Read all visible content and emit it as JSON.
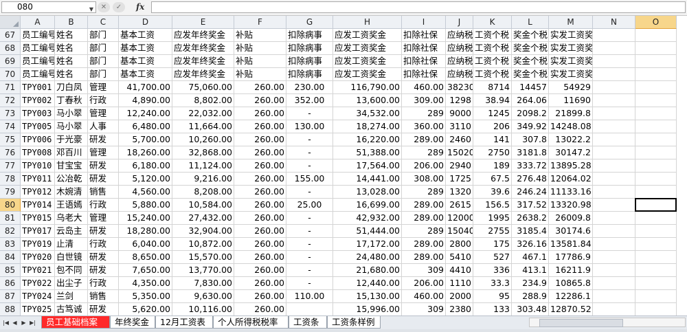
{
  "formula_bar": {
    "name_box": "080",
    "fx_label": "fx",
    "formula": ""
  },
  "columns": [
    "A",
    "B",
    "C",
    "D",
    "E",
    "F",
    "G",
    "H",
    "I",
    "J",
    "K",
    "L",
    "M",
    "N",
    "O"
  ],
  "selected_column": "O",
  "selected_row": "80",
  "rows": [
    {
      "n": "67",
      "cells": [
        "员工编号",
        "姓名",
        "部门",
        "基本工资",
        "应发年终奖金",
        "补贴",
        "扣除病事",
        "应发工资奖金",
        "扣除社保",
        "应纳税",
        "工资个税",
        "奖金个税",
        "实发工资奖金"
      ]
    },
    {
      "n": "68",
      "cells": [
        "员工编号",
        "姓名",
        "部门",
        "基本工资",
        "应发年终奖金",
        "补贴",
        "扣除病事",
        "应发工资奖金",
        "扣除社保",
        "应纳税",
        "工资个税",
        "奖金个税",
        "实发工资奖金"
      ]
    },
    {
      "n": "69",
      "cells": [
        "员工编号",
        "姓名",
        "部门",
        "基本工资",
        "应发年终奖金",
        "补贴",
        "扣除病事",
        "应发工资奖金",
        "扣除社保",
        "应纳税",
        "工资个税",
        "奖金个税",
        "实发工资奖金"
      ]
    },
    {
      "n": "70",
      "cells": [
        "员工编号",
        "姓名",
        "部门",
        "基本工资",
        "应发年终奖金",
        "补贴",
        "扣除病事",
        "应发工资奖金",
        "扣除社保",
        "应纳税",
        "工资个税",
        "奖金个税",
        "实发工资奖金"
      ]
    },
    {
      "n": "71",
      "cells": [
        "TPY001",
        "刀白凤",
        "管理",
        "41,700.00",
        "75,060.00",
        "260.00",
        "230.00",
        "116,790.00",
        "460.00",
        "38230",
        "8714",
        "14457",
        "54929"
      ]
    },
    {
      "n": "72",
      "cells": [
        "TPY002",
        "丁春秋",
        "行政",
        "4,890.00",
        "8,802.00",
        "260.00",
        "352.00",
        "13,600.00",
        "309.00",
        "1298",
        "38.94",
        "264.06",
        "11690"
      ]
    },
    {
      "n": "73",
      "cells": [
        "TPY003",
        "马小翠",
        "管理",
        "12,240.00",
        "22,032.00",
        "260.00",
        "-",
        "34,532.00",
        "289",
        "9000",
        "1245",
        "2098.2",
        "21899.8"
      ]
    },
    {
      "n": "74",
      "cells": [
        "TPY005",
        "马小翠",
        "人事",
        "6,480.00",
        "11,664.00",
        "260.00",
        "130.00",
        "18,274.00",
        "360.00",
        "3110",
        "206",
        "349.92",
        "14248.08"
      ]
    },
    {
      "n": "75",
      "cells": [
        "TPY006",
        "于光豪",
        "研发",
        "5,700.00",
        "10,260.00",
        "260.00",
        "-",
        "16,220.00",
        "289.00",
        "2460",
        "141",
        "307.8",
        "13022.2"
      ]
    },
    {
      "n": "76",
      "cells": [
        "TPY008",
        "邓百川",
        "管理",
        "18,260.00",
        "32,868.00",
        "260.00",
        "-",
        "51,388.00",
        "289",
        "15020",
        "2750",
        "3181.8",
        "30147.2"
      ]
    },
    {
      "n": "77",
      "cells": [
        "TPY010",
        "甘宝宝",
        "研发",
        "6,180.00",
        "11,124.00",
        "260.00",
        "-",
        "17,564.00",
        "206.00",
        "2940",
        "189",
        "333.72",
        "13895.28"
      ]
    },
    {
      "n": "78",
      "cells": [
        "TPY011",
        "公冶乾",
        "研发",
        "5,120.00",
        "9,216.00",
        "260.00",
        "155.00",
        "14,441.00",
        "308.00",
        "1725",
        "67.5",
        "276.48",
        "12064.02"
      ]
    },
    {
      "n": "79",
      "cells": [
        "TPY012",
        "木婉清",
        "销售",
        "4,560.00",
        "8,208.00",
        "260.00",
        "-",
        "13,028.00",
        "289",
        "1320",
        "39.6",
        "246.24",
        "11133.16"
      ]
    },
    {
      "n": "80",
      "cells": [
        "TPY014",
        "王语嫣",
        "行政",
        "5,880.00",
        "10,584.00",
        "260.00",
        "25.00",
        "16,699.00",
        "289.00",
        "2615",
        "156.5",
        "317.52",
        "13320.98"
      ]
    },
    {
      "n": "81",
      "cells": [
        "TPY015",
        "乌老大",
        "管理",
        "15,240.00",
        "27,432.00",
        "260.00",
        "-",
        "42,932.00",
        "289.00",
        "12000",
        "1995",
        "2638.2",
        "26009.8"
      ]
    },
    {
      "n": "82",
      "cells": [
        "TPY017",
        "云岛主",
        "研发",
        "18,280.00",
        "32,904.00",
        "260.00",
        "-",
        "51,444.00",
        "289",
        "15040",
        "2755",
        "3185.4",
        "30174.6"
      ]
    },
    {
      "n": "83",
      "cells": [
        "TPY019",
        "止清",
        "行政",
        "6,040.00",
        "10,872.00",
        "260.00",
        "-",
        "17,172.00",
        "289.00",
        "2800",
        "175",
        "326.16",
        "13581.84"
      ]
    },
    {
      "n": "84",
      "cells": [
        "TPY020",
        "白世镜",
        "研发",
        "8,650.00",
        "15,570.00",
        "260.00",
        "-",
        "24,480.00",
        "289.00",
        "5410",
        "527",
        "467.1",
        "17786.9"
      ]
    },
    {
      "n": "85",
      "cells": [
        "TPY021",
        "包不同",
        "研发",
        "7,650.00",
        "13,770.00",
        "260.00",
        "-",
        "21,680.00",
        "309",
        "4410",
        "336",
        "413.1",
        "16211.9"
      ]
    },
    {
      "n": "86",
      "cells": [
        "TPY022",
        "出尘子",
        "行政",
        "4,350.00",
        "7,830.00",
        "260.00",
        "-",
        "12,440.00",
        "206.00",
        "1110",
        "33.3",
        "234.9",
        "10865.8"
      ]
    },
    {
      "n": "87",
      "cells": [
        "TPY024",
        "兰剑",
        "销售",
        "5,350.00",
        "9,630.00",
        "260.00",
        "110.00",
        "15,130.00",
        "460.00",
        "2000",
        "95",
        "288.9",
        "12286.1"
      ]
    },
    {
      "n": "88",
      "cells": [
        "TPY025",
        "古笃诚",
        "研发",
        "5,620.00",
        "10,116.00",
        "260.00",
        "",
        "15,996.00",
        "309",
        "2380",
        "133",
        "303.48",
        "12870.52"
      ]
    }
  ],
  "sheet_tabs": [
    {
      "label": "员工基础档案",
      "active": true
    },
    {
      "label": "年终奖金",
      "active": false
    },
    {
      "label": "12月工资表",
      "active": false
    },
    {
      "label": "个人所得税税率",
      "active": false
    },
    {
      "label": "工资条",
      "active": false
    },
    {
      "label": "工资条样例",
      "active": false
    }
  ],
  "icons": {
    "nav": [
      "first-sheet-icon",
      "prev-sheet-icon",
      "next-sheet-icon",
      "last-sheet-icon"
    ],
    "fx": "function-icon"
  }
}
